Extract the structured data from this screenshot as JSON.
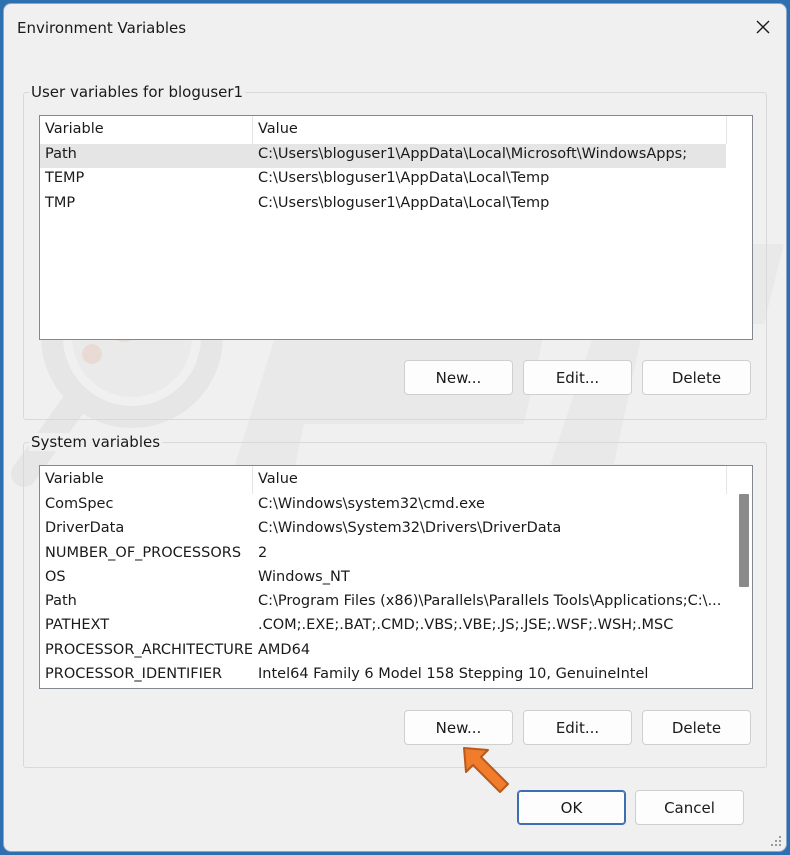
{
  "window": {
    "title": "Environment Variables"
  },
  "user_section": {
    "label": "User variables for bloguser1",
    "columns": [
      "Variable",
      "Value"
    ],
    "rows": [
      {
        "variable": "Path",
        "value": "C:\\Users\\bloguser1\\AppData\\Local\\Microsoft\\WindowsApps;",
        "selected": true
      },
      {
        "variable": "TEMP",
        "value": "C:\\Users\\bloguser1\\AppData\\Local\\Temp"
      },
      {
        "variable": "TMP",
        "value": "C:\\Users\\bloguser1\\AppData\\Local\\Temp"
      }
    ],
    "buttons": {
      "new": "New...",
      "edit": "Edit...",
      "delete": "Delete"
    }
  },
  "system_section": {
    "label": "System variables",
    "columns": [
      "Variable",
      "Value"
    ],
    "rows": [
      {
        "variable": "ComSpec",
        "value": "C:\\Windows\\system32\\cmd.exe"
      },
      {
        "variable": "DriverData",
        "value": "C:\\Windows\\System32\\Drivers\\DriverData"
      },
      {
        "variable": "NUMBER_OF_PROCESSORS",
        "value": "2"
      },
      {
        "variable": "OS",
        "value": "Windows_NT"
      },
      {
        "variable": "Path",
        "value": "C:\\Program Files (x86)\\Parallels\\Parallels Tools\\Applications;C:\\..."
      },
      {
        "variable": "PATHEXT",
        "value": ".COM;.EXE;.BAT;.CMD;.VBS;.VBE;.JS;.JSE;.WSF;.WSH;.MSC"
      },
      {
        "variable": "PROCESSOR_ARCHITECTURE",
        "value": "AMD64"
      },
      {
        "variable": "PROCESSOR_IDENTIFIER",
        "value": "Intel64 Family 6 Model 158 Stepping 10, GenuineIntel"
      }
    ],
    "buttons": {
      "new": "New...",
      "edit": "Edit...",
      "delete": "Delete"
    }
  },
  "footer": {
    "ok": "OK",
    "cancel": "Cancel"
  },
  "icons": {
    "close": "close-icon",
    "pointer": "pointer-arrow-icon",
    "resize": "resize-grip-icon",
    "watermark": "magnifier-watermark"
  },
  "colors": {
    "selection": "#e5e5e5",
    "accent_border": "#3b6fb0",
    "arrow": "#f07c2c"
  }
}
